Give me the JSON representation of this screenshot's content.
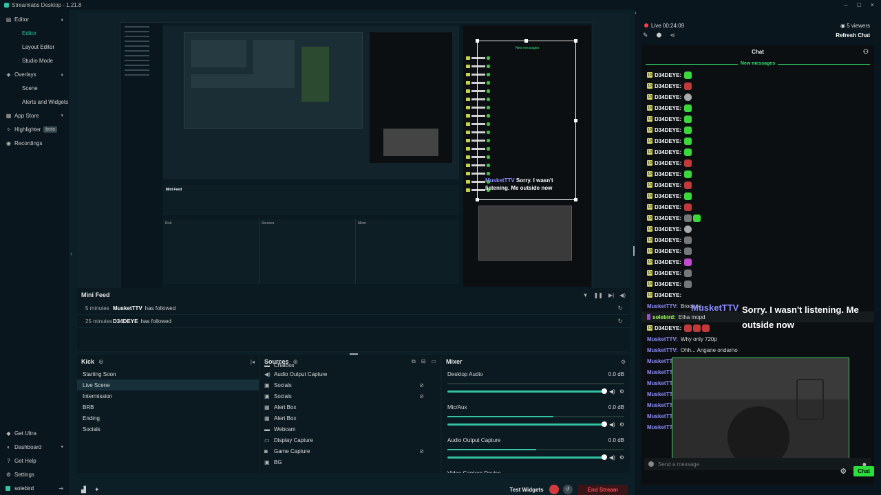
{
  "window": {
    "title": "Streamlabs Desktop - 1.21.8",
    "controls": [
      "–",
      "□",
      "×"
    ]
  },
  "sidebar": {
    "items": [
      {
        "label": "Editor",
        "icon": "editor-icon",
        "expanded": true
      },
      {
        "label": "Editor",
        "sub": true,
        "active": true
      },
      {
        "label": "Layout Editor",
        "sub": true
      },
      {
        "label": "Studio Mode",
        "sub": true
      },
      {
        "label": "Overlays",
        "icon": "overlays-icon",
        "expanded": true
      },
      {
        "label": "Scene",
        "sub": true
      },
      {
        "label": "Alerts and Widgets",
        "sub": true
      },
      {
        "label": "App Store",
        "icon": "app-store-icon"
      },
      {
        "label": "Highlighter",
        "icon": "highlighter-icon",
        "badge": "beta"
      },
      {
        "label": "Recordings",
        "icon": "recordings-icon"
      }
    ],
    "bottom": [
      {
        "label": "Get Ultra",
        "icon": "ultra-icon"
      },
      {
        "label": "Dashboard",
        "icon": "dashboard-icon"
      },
      {
        "label": "Get Help",
        "icon": "help-icon"
      },
      {
        "label": "Settings",
        "icon": "settings-icon"
      }
    ],
    "user": "solebird"
  },
  "minifeed": {
    "title": "Mini Feed",
    "rows": [
      {
        "time": "5 minutes",
        "user": "MusketTTV",
        "action": "has followed"
      },
      {
        "time": "25 minutes",
        "user": "D34DEYE",
        "action": "has followed"
      }
    ]
  },
  "scenes": {
    "title": "Kick",
    "items": [
      "Starting Soon",
      "Live Scene",
      "Intermission",
      "BRB",
      "Ending",
      "Socials"
    ],
    "active_index": 1
  },
  "sources": {
    "title": "Sources",
    "items": [
      {
        "label": "Chatbox",
        "icon": "folder-icon",
        "partial": true
      },
      {
        "label": "Audio Output Capture",
        "icon": "speaker-icon"
      },
      {
        "label": "Socials",
        "icon": "image-icon",
        "hidden": true
      },
      {
        "label": "Socials",
        "icon": "image-icon",
        "hidden": true
      },
      {
        "label": "Alert Box",
        "icon": "widget-icon"
      },
      {
        "label": "Alert Box",
        "icon": "widget-icon"
      },
      {
        "label": "Webcam",
        "icon": "folder-icon"
      },
      {
        "label": "Display Capture",
        "icon": "monitor-icon"
      },
      {
        "label": "Game Capture",
        "icon": "gamepad-icon",
        "hidden": true
      },
      {
        "label": "BG",
        "icon": "image-icon"
      }
    ]
  },
  "mixer": {
    "title": "Mixer",
    "channels": [
      {
        "name": "Desktop Audio",
        "db": "0.0 dB",
        "level": 0.0
      },
      {
        "name": "Mic/Aux",
        "db": "0.0 dB",
        "level": 0.6
      },
      {
        "name": "Audio Output Capture",
        "db": "0.0 dB",
        "level": 0.5
      },
      {
        "name": "Video Capture Device",
        "db": "",
        "partial": true
      }
    ]
  },
  "footer": {
    "test_widgets": "Test Widgets",
    "end_stream": "End Stream"
  },
  "stream": {
    "live_label": "Live 00:24:09",
    "viewers": "5 viewers",
    "refresh_chat": "Refresh Chat"
  },
  "chat": {
    "title": "Chat",
    "new_messages": "New messages",
    "messages": [
      {
        "name": "D34DEYE:",
        "badge": true,
        "emotes": [
          "g"
        ]
      },
      {
        "name": "D34DEYE:",
        "badge": true,
        "emotes": [
          "r"
        ]
      },
      {
        "name": "D34DEYE:",
        "badge": true,
        "emotes": [
          "w"
        ]
      },
      {
        "name": "D34DEYE:",
        "badge": true,
        "emotes": [
          "g"
        ]
      },
      {
        "name": "D34DEYE:",
        "badge": true,
        "emotes": [
          "g"
        ]
      },
      {
        "name": "D34DEYE:",
        "badge": true,
        "emotes": [
          "g"
        ]
      },
      {
        "name": "D34DEYE:",
        "badge": true,
        "emotes": [
          "g"
        ]
      },
      {
        "name": "D34DEYE:",
        "badge": true,
        "emotes": [
          "g"
        ]
      },
      {
        "name": "D34DEYE:",
        "badge": true,
        "emotes": [
          "r"
        ]
      },
      {
        "name": "D34DEYE:",
        "badge": true,
        "emotes": [
          "g"
        ]
      },
      {
        "name": "D34DEYE:",
        "badge": true,
        "emotes": [
          "r"
        ]
      },
      {
        "name": "D34DEYE:",
        "badge": true,
        "emotes": [
          "g"
        ]
      },
      {
        "name": "D34DEYE:",
        "badge": true,
        "emotes": [
          "r"
        ]
      },
      {
        "name": "D34DEYE:",
        "badge": true,
        "emotes": [
          "m",
          "g"
        ]
      },
      {
        "name": "D34DEYE:",
        "badge": true,
        "emotes": [
          "w"
        ]
      },
      {
        "name": "D34DEYE:",
        "badge": true,
        "emotes": [
          "m"
        ]
      },
      {
        "name": "D34DEYE:",
        "badge": true,
        "emotes": [
          "m"
        ]
      },
      {
        "name": "D34DEYE:",
        "badge": true,
        "emotes": [
          "p"
        ]
      },
      {
        "name": "D34DEYE:",
        "badge": true,
        "emotes": [
          "m"
        ]
      },
      {
        "name": "D34DEYE:",
        "badge": true,
        "emotes": [
          "m"
        ]
      },
      {
        "name": "D34DEYE:",
        "badge": true,
        "emotes": []
      },
      {
        "name": "MusketTTV:",
        "color": "blue",
        "text": "Brooooo"
      },
      {
        "name": "solebird:",
        "color": "green",
        "text": "Etha mopd",
        "highlight": true
      },
      {
        "name": "D34DEYE:",
        "badge": true,
        "emotes": [
          "r",
          "r",
          "r"
        ]
      },
      {
        "name": "MusketTTV:",
        "color": "blue",
        "text": "Why only 720p"
      },
      {
        "name": "MusketTTV:",
        "color": "blue",
        "text": "Ohh... Angane ondarno"
      },
      {
        "name": "MusketTTV",
        "color": "blue",
        "text": ""
      },
      {
        "name": "MusketTTV",
        "color": "blue",
        "text": ""
      },
      {
        "name": "MusketTTV",
        "color": "blue",
        "text": ""
      },
      {
        "name": "MusketTTV",
        "color": "blue",
        "text": ""
      },
      {
        "name": "MusketTTV",
        "color": "blue",
        "text": ""
      },
      {
        "name": "MusketTTV",
        "color": "blue",
        "text": ""
      },
      {
        "name": "MusketTTV",
        "color": "blue",
        "text": ""
      }
    ],
    "overlay": {
      "name": "MusketTTV",
      "message": "Sorry. I wasn't listening. Me outside now"
    },
    "input_placeholder": "Send a message",
    "send_label": "Chat"
  },
  "preview_overlay": {
    "name": "MusketTTV",
    "message": "Sorry. I wasn't listening. Me outside now"
  },
  "colors": {
    "accent": "#31c3a2",
    "live": "#ff3a4a",
    "chat_green": "#2adf3a",
    "bg": "#09161d"
  }
}
